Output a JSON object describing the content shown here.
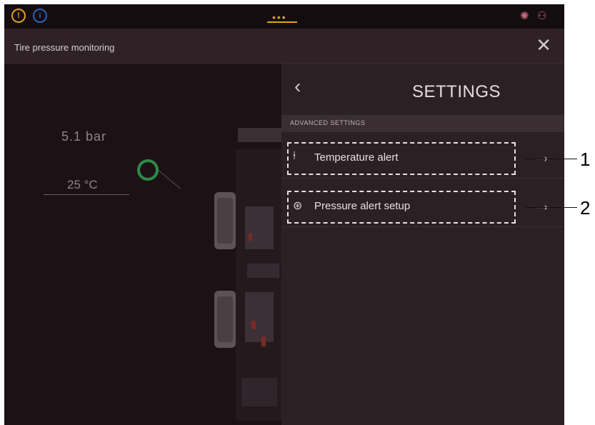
{
  "topbar": {
    "warning_icon": "warning-circle-icon",
    "info_icon": "info-circle-icon",
    "menu_glyph": "•••",
    "right_icons": [
      "settings-gear-icon",
      "network-icon"
    ]
  },
  "header": {
    "title": "Tire pressure monitoring",
    "close_glyph": "✕"
  },
  "tire_view": {
    "pressure": "5.1 bar",
    "temperature": "25 °C"
  },
  "settings_panel": {
    "back_glyph": "‹",
    "title": "SETTINGS",
    "section_label": "ADVANCED SETTINGS",
    "items": [
      {
        "label": "Temperature alert",
        "icon": "thermometer-alert-icon",
        "arrow": "→"
      },
      {
        "label": "Pressure alert setup",
        "icon": "pressure-gauge-icon",
        "arrow": "→"
      }
    ]
  },
  "callouts": [
    "1",
    "2"
  ],
  "colors": {
    "accent": "#e0a21a",
    "info": "#2c5fb8",
    "tire_status_ok": "#2e8a46",
    "background": "#2a1f23"
  }
}
